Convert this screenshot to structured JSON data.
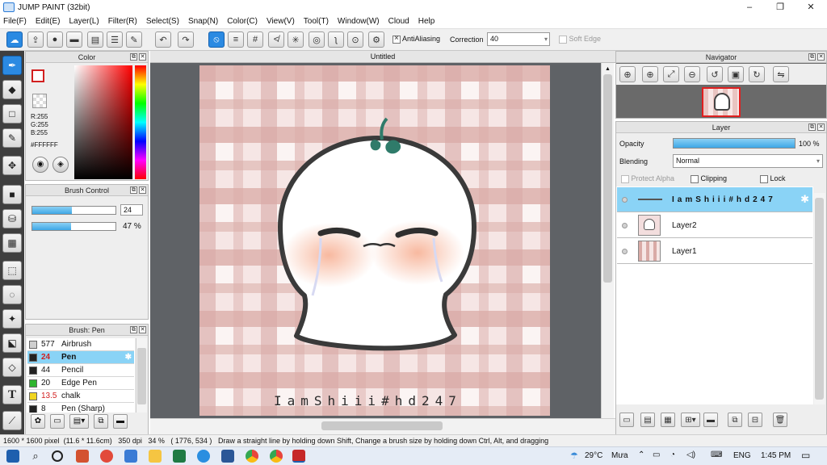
{
  "window": {
    "title": "JUMP PAINT (32bit)",
    "minimize": "–",
    "maximize": "❐",
    "close": "✕"
  },
  "menu": [
    "File(F)",
    "Edit(E)",
    "Layer(L)",
    "Filter(R)",
    "Select(S)",
    "Snap(N)",
    "Color(C)",
    "View(V)",
    "Tool(T)",
    "Window(W)",
    "Cloud",
    "Help"
  ],
  "toolbar": {
    "antialiasing_label": "AntiAliasing",
    "correction_label": "Correction",
    "correction_value": "40",
    "softedge_label": "Soft Edge"
  },
  "color_panel": {
    "title": "Color",
    "r": "R:255",
    "g": "G:255",
    "b": "B:255",
    "hex": "#FFFFFF"
  },
  "brush_control": {
    "title": "Brush Control",
    "size": "24",
    "size_fraction": 0.48,
    "density": "47 %",
    "density_fraction": 0.47
  },
  "brush_panel": {
    "title": "Brush: Pen",
    "items": [
      {
        "size": "577",
        "name": "Airbrush",
        "color": "#cfcfcf"
      },
      {
        "size": "24",
        "name": "Pen",
        "color": "#222222"
      },
      {
        "size": "44",
        "name": "Pencil",
        "color": "#222222"
      },
      {
        "size": "20",
        "name": "Edge Pen",
        "color": "#2fb52f"
      },
      {
        "size": "13.5",
        "name": "chalk",
        "color": "#f0d520"
      },
      {
        "size": "8",
        "name": "Pen (Sharp)",
        "color": "#222222"
      }
    ]
  },
  "document": {
    "tab": "Untitled",
    "signature": "IamShiii#hd247"
  },
  "navigator": {
    "title": "Navigator"
  },
  "layer_panel": {
    "title": "Layer",
    "opacity_label": "Opacity",
    "opacity_value": "100 %",
    "opacity_fraction": 1.0,
    "blending_label": "Blending",
    "blending_value": "Normal",
    "protect_alpha": "Protect Alpha",
    "clipping": "Clipping",
    "lock": "Lock",
    "layers": [
      {
        "name": "IamShiii#hd247",
        "selected": true
      },
      {
        "name": "Layer2",
        "selected": false
      },
      {
        "name": "Layer1",
        "selected": false
      }
    ]
  },
  "status": {
    "size": "1600 * 1600 pixel",
    "cm": "(11.6 * 11.6cm)",
    "dpi": "350 dpi",
    "zoom": "34 %",
    "coords": "( 1776, 534 )",
    "hint": "Draw a straight line by holding down Shift, Change a brush size by holding down Ctrl, Alt, and dragging"
  },
  "taskbar": {
    "weather": "29°C",
    "weather_text": "Mưa",
    "lang": "ENG",
    "time": "1:45 PM"
  },
  "colors": {
    "accent": "#2b8ae2",
    "selection": "#8ad3f6",
    "plaid_base": "#f6e6e5",
    "plaid_stripe": "#d9aaa6"
  }
}
